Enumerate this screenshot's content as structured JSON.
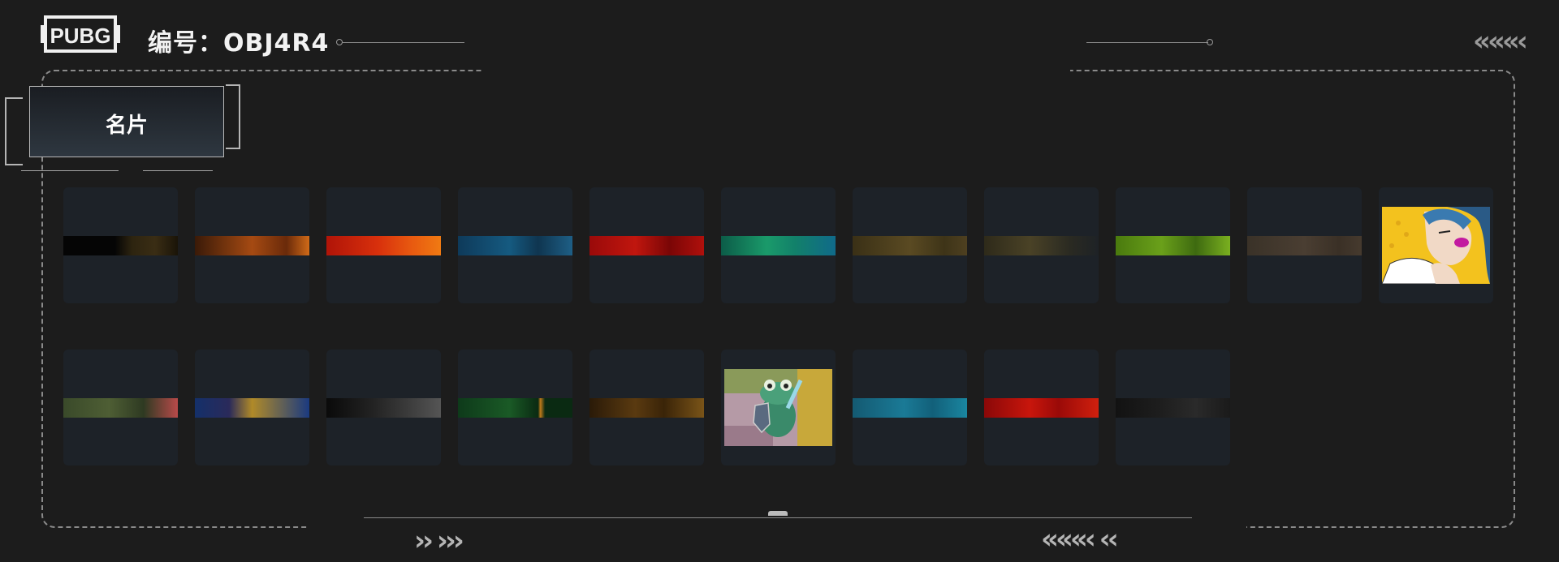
{
  "header": {
    "logo_text": "PUBG",
    "code_label": "编号：",
    "code_value": "OBJ4R4"
  },
  "tab": {
    "label": "名片"
  },
  "cards_row1": [
    {
      "style": "linear-gradient(90deg,#050505 45%,#2d2410 60%,#3a2d14 80%,#1a1408)"
    },
    {
      "style": "linear-gradient(90deg,#3a1a08,#a54a12 50%,#6a2a0a 80%,#d06a18)"
    },
    {
      "style": "linear-gradient(90deg,#b01408,#d8300c 45%,#e85a10 75%,#f07a12)"
    },
    {
      "style": "linear-gradient(90deg,#0e3a5a,#155a80 45%,#0f3550 70%,#1e5f86)"
    },
    {
      "style": "linear-gradient(90deg,#9a0a0a,#c0160e 40%,#7a0606 70%,#b0100c)"
    },
    {
      "style": "linear-gradient(90deg,#0c5c48,#1a9a6a 40%,#12806a 65%,#106a8a)"
    },
    {
      "style": "linear-gradient(90deg,#3a3016,#5a4a22 50%,#3e3418 80%,#4e4020)"
    },
    {
      "style": "linear-gradient(90deg,#2e2a1a,#4a4226 40%,#2a2a22 75%,#1e2226)"
    },
    {
      "style": "linear-gradient(90deg,#4a7a0e,#6aa01a 40%,#3e6a10 70%,#7ab020)"
    },
    {
      "style": "linear-gradient(90deg,#3a3228,#4a3e32 50%,#3a3026 80%,#463a2e)"
    },
    {
      "style": "pic-comic"
    }
  ],
  "cards_row2": [
    {
      "style": "linear-gradient(90deg,#3a4a2a,#4e5e34 40%,#2e3a22 70%,#b84a4a)"
    },
    {
      "style": "linear-gradient(90deg,#14306a,#2a2a5a 30%,#b08a28 50%,#1a3a80)"
    },
    {
      "style": "linear-gradient(90deg,#0a0a0a,#222 40%,#3a3a3a 70%,#555)"
    },
    {
      "style": "linear-gradient(90deg,#0e3a1a,#1a5a26 45%,#0a2a12 70%,#c07a1a 72%,#0a2a12 76%)"
    },
    {
      "style": "linear-gradient(90deg,#2a1a08,#5a3a10 40%,#3a2408 65%,#7a5418)"
    },
    {
      "style": "pic-frog"
    },
    {
      "style": "linear-gradient(90deg,#145a72,#1a7a96 45%,#12607a 70%,#1a86a0)"
    },
    {
      "style": "linear-gradient(90deg,#8a0808,#c8160c 40%,#9a0a08 65%,#d0200e)"
    },
    {
      "style": "linear-gradient(90deg,#121212,#1e1e1e 40%,#2a2a2a 70%,#1a1a1a)"
    }
  ],
  "colors": {
    "background": "#1c1c1c",
    "card": "#1d2228",
    "frame": "#8a8a8a"
  },
  "icons": [
    "pubg-logo",
    "chevron-left-icon",
    "chevron-right-icon"
  ]
}
